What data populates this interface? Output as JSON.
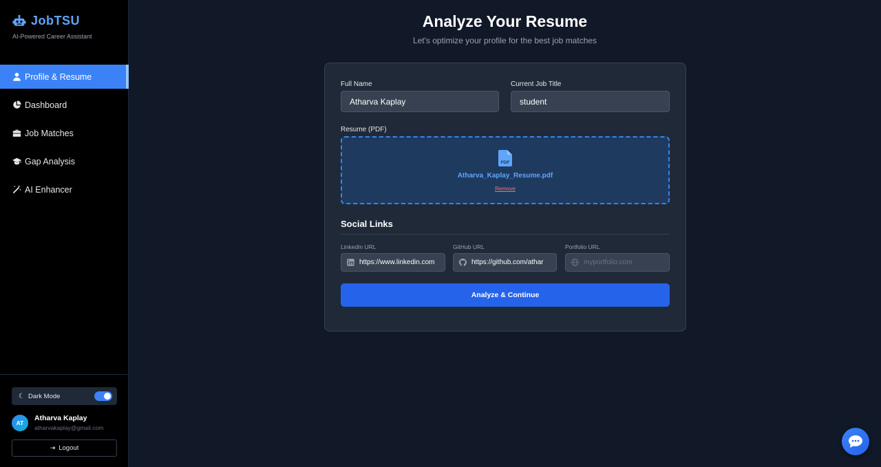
{
  "brand": {
    "title": "JobTSU",
    "subtitle": "AI-Powered Career Assistant",
    "icon": "robot-icon"
  },
  "nav": [
    {
      "label": "Profile & Resume",
      "icon": "user-icon",
      "active": true
    },
    {
      "label": "Dashboard",
      "icon": "pie-chart-icon",
      "active": false
    },
    {
      "label": "Job Matches",
      "icon": "briefcase-icon",
      "active": false
    },
    {
      "label": "Gap Analysis",
      "icon": "graduation-cap-icon",
      "active": false
    },
    {
      "label": "AI Enhancer",
      "icon": "magic-wand-icon",
      "active": false
    }
  ],
  "dark_mode": {
    "label": "Dark Mode",
    "enabled": true
  },
  "user": {
    "initials": "AT",
    "name": "Atharva Kaplay",
    "email": "atharvakaplay@gmail.com"
  },
  "logout_label": "Logout",
  "header": {
    "title": "Analyze Your Resume",
    "subtitle": "Let's optimize your profile for the best job matches"
  },
  "form": {
    "full_name": {
      "label": "Full Name",
      "value": "Atharva Kaplay"
    },
    "job_title": {
      "label": "Current Job Title",
      "value": "student"
    },
    "resume": {
      "label": "Resume (PDF)",
      "file_name": "Atharva_Kaplay_Resume.pdf",
      "remove_label": "Remove",
      "icon_text": "PDF"
    },
    "social": {
      "title": "Social Links",
      "linkedin": {
        "label": "LinkedIn URL",
        "value": "https://www.linkedin.com",
        "icon": "linkedin-icon"
      },
      "github": {
        "label": "GitHub URL",
        "value": "https://github.com/athar",
        "icon": "github-icon"
      },
      "portfolio": {
        "label": "Portfolio URL",
        "placeholder": "myportfolio.com",
        "icon": "globe-icon"
      }
    },
    "submit_label": "Analyze & Continue"
  },
  "colors": {
    "accent": "#3b82f6",
    "background": "#111827",
    "sidebar": "#000000",
    "card": "#1f2937",
    "danger": "#f87171"
  }
}
